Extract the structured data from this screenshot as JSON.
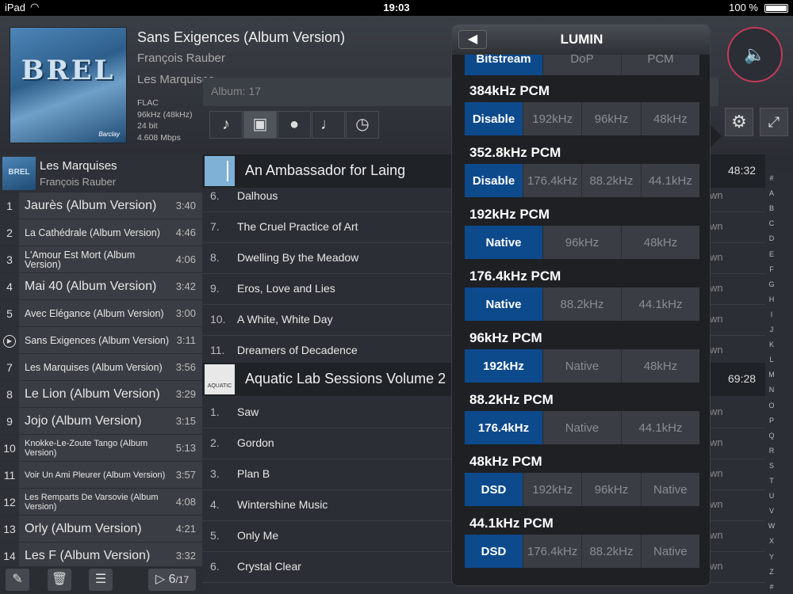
{
  "status_bar": {
    "device": "iPad",
    "time": "19:03",
    "battery": "100 %"
  },
  "now_playing": {
    "cover_text": "BREL",
    "cover_sig": "Barclay",
    "title": "Sans Exigences (Album Version)",
    "artist": "François Rauber",
    "album": "Les Marquises",
    "format": "FLAC",
    "rate": "96kHz (48kHz)",
    "bits": "24 bit",
    "bitrate": "4.608 Mbps"
  },
  "browse": {
    "album_count": "Album: 17"
  },
  "playlist": {
    "album": "Les Marquises",
    "artist": "François Rauber",
    "thumb_text": "BREL",
    "items": [
      {
        "num": "1",
        "title": "Jaurès (Album Version)",
        "dur": "3:40"
      },
      {
        "num": "2",
        "title": "La Cathédrale (Album Version)",
        "dur": "4:46"
      },
      {
        "num": "3",
        "title": "L'Amour Est Mort (Album Version)",
        "dur": "4:06"
      },
      {
        "num": "4",
        "title": "Mai 40 (Album Version)",
        "dur": "3:42"
      },
      {
        "num": "5",
        "title": "Avec Elégance (Album Version)",
        "dur": "3:00"
      },
      {
        "num": "",
        "title": "Sans Exigences (Album Version)",
        "dur": "3:11"
      },
      {
        "num": "7",
        "title": "Les Marquises (Album Version)",
        "dur": "3:56"
      },
      {
        "num": "8",
        "title": "Le Lion (Album Version)",
        "dur": "3:29"
      },
      {
        "num": "9",
        "title": "Jojo (Album Version)",
        "dur": "3:15"
      },
      {
        "num": "10",
        "title": "Knokke-Le-Zoute Tango (Album Version)",
        "dur": "5:13"
      },
      {
        "num": "11",
        "title": "Voir Un Ami Pleurer (Album Version)",
        "dur": "3:57"
      },
      {
        "num": "12",
        "title": "Les Remparts De Varsovie (Album Version)",
        "dur": "4:08"
      },
      {
        "num": "13",
        "title": "Orly (Album Version)",
        "dur": "4:21"
      },
      {
        "num": "14",
        "title": "Les F (Album Version)",
        "dur": "3:32"
      }
    ],
    "counter_num": "6",
    "counter_den": "17"
  },
  "tracks": {
    "album1": {
      "name": "An Ambassador for Laing",
      "dur": "48:32"
    },
    "album1_tracks": [
      {
        "n": "6.",
        "t": "Dalhous",
        "w": "wn"
      },
      {
        "n": "7.",
        "t": "The Cruel Practice of Art",
        "w": "wn"
      },
      {
        "n": "8.",
        "t": "Dwelling By the Meadow",
        "w": "wn"
      },
      {
        "n": "9.",
        "t": "Eros, Love and Lies",
        "w": "wn"
      },
      {
        "n": "10.",
        "t": "A White, White Day",
        "w": "wn"
      },
      {
        "n": "11.",
        "t": "Dreamers of Decadence",
        "w": "wn"
      }
    ],
    "album2": {
      "name": "Aquatic Lab Sessions Volume 2",
      "dur": "69:28",
      "thumb_text": "AQUATIC"
    },
    "album2_tracks": [
      {
        "n": "1.",
        "t": "Saw",
        "w": "wn"
      },
      {
        "n": "2.",
        "t": "Gordon",
        "w": "wn"
      },
      {
        "n": "3.",
        "t": "Plan B",
        "w": "wn"
      },
      {
        "n": "4.",
        "t": "Wintershine Music",
        "w": "wn"
      },
      {
        "n": "5.",
        "t": "Only Me",
        "w": "wn"
      },
      {
        "n": "6.",
        "t": "Crystal Clear",
        "w": "wn"
      }
    ]
  },
  "index_letters": [
    "#",
    "A",
    "B",
    "C",
    "D",
    "E",
    "F",
    "G",
    "H",
    "I",
    "J",
    "K",
    "L",
    "M",
    "N",
    "O",
    "P",
    "Q",
    "R",
    "S",
    "T",
    "U",
    "V",
    "W",
    "X",
    "Y",
    "Z",
    "#"
  ],
  "popup": {
    "title": "LUMIN",
    "top_partial": [
      "Bitstream",
      "DoP",
      "PCM"
    ],
    "sections": [
      {
        "label": "384kHz PCM",
        "options": [
          "Disable",
          "192kHz",
          "96kHz",
          "48kHz"
        ],
        "selected": 0
      },
      {
        "label": "352.8kHz PCM",
        "options": [
          "Disable",
          "176.4kHz",
          "88.2kHz",
          "44.1kHz"
        ],
        "selected": 0
      },
      {
        "label": "192kHz PCM",
        "options": [
          "Native",
          "96kHz",
          "48kHz"
        ],
        "selected": 0
      },
      {
        "label": "176.4kHz PCM",
        "options": [
          "Native",
          "88.2kHz",
          "44.1kHz"
        ],
        "selected": 0
      },
      {
        "label": "96kHz PCM",
        "options": [
          "192kHz",
          "Native",
          "48kHz"
        ],
        "selected": 0
      },
      {
        "label": "88.2kHz PCM",
        "options": [
          "176.4kHz",
          "Native",
          "44.1kHz"
        ],
        "selected": 0
      },
      {
        "label": "48kHz PCM",
        "options": [
          "DSD",
          "192kHz",
          "96kHz",
          "Native"
        ],
        "selected": 0
      },
      {
        "label": "44.1kHz PCM",
        "options": [
          "DSD",
          "176.4kHz",
          "88.2kHz",
          "Native"
        ],
        "selected": 0
      }
    ]
  },
  "colors": {
    "accent": "#0d4a8c",
    "volume_ring": "#c33a5a"
  }
}
